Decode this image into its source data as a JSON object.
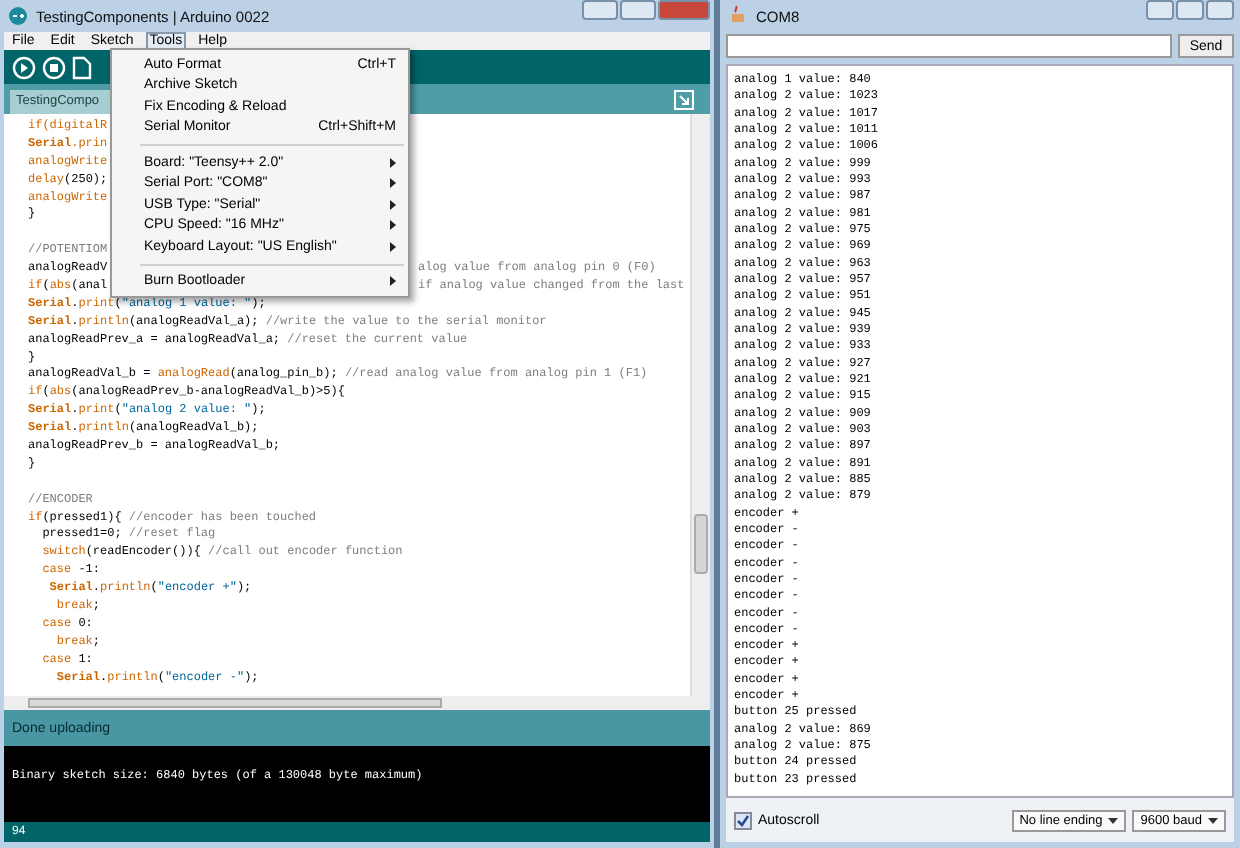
{
  "ide": {
    "title": "TestingComponents | Arduino 0022",
    "menubar": [
      {
        "label": "File",
        "selected": false
      },
      {
        "label": "Edit",
        "selected": false
      },
      {
        "label": "Sketch",
        "selected": false
      },
      {
        "label": "Tools",
        "selected": true
      },
      {
        "label": "Help",
        "selected": false
      }
    ],
    "tab": "TestingCompo",
    "code": [
      {
        "parts": [
          {
            "kind": "kw",
            "t": "if(digitalR"
          }
        ]
      },
      {
        "parts": [
          {
            "kind": "cls",
            "t": "Serial"
          },
          {
            "kind": "kw",
            "t": ".prin"
          }
        ]
      },
      {
        "parts": [
          {
            "kind": "kw",
            "t": "analogWrite"
          }
        ]
      },
      {
        "parts": [
          {
            "kind": "kw",
            "t": "delay"
          },
          {
            "kind": "plain",
            "t": "(250);"
          }
        ]
      },
      {
        "parts": [
          {
            "kind": "kw",
            "t": "analogWrite"
          }
        ]
      },
      {
        "parts": [
          {
            "kind": "plain",
            "t": "}"
          }
        ]
      },
      {
        "space_before": true,
        "parts": [
          {
            "kind": "cmt",
            "t": "//POTENTIOM"
          }
        ]
      },
      {
        "parts": [
          {
            "kind": "plain",
            "t": "analogReadV"
          }
        ],
        "tail": [
          {
            "kind": "cmt",
            "t": "alog value from analog pin 0 (F0)"
          }
        ]
      },
      {
        "parts": [
          {
            "kind": "kw",
            "t": "if"
          },
          {
            "kind": "plain",
            "t": "("
          },
          {
            "kind": "kw",
            "t": "abs"
          },
          {
            "kind": "plain",
            "t": "(anal"
          }
        ],
        "tail": [
          {
            "kind": "cmt",
            "t": "if analog value changed from the last"
          }
        ]
      },
      {
        "parts": [
          {
            "kind": "cls",
            "t": "Serial"
          },
          {
            "kind": "plain",
            "t": "."
          },
          {
            "kind": "kw",
            "t": "print"
          },
          {
            "kind": "plain",
            "t": "("
          },
          {
            "kind": "str",
            "t": "\"analog 1 value: \""
          },
          {
            "kind": "plain",
            "t": ");"
          }
        ]
      },
      {
        "parts": [
          {
            "kind": "cls",
            "t": "Serial"
          },
          {
            "kind": "plain",
            "t": "."
          },
          {
            "kind": "kw",
            "t": "println"
          },
          {
            "kind": "plain",
            "t": "(analogReadVal_a); "
          },
          {
            "kind": "cmt",
            "t": "//write the value to the serial monitor"
          }
        ]
      },
      {
        "parts": [
          {
            "kind": "plain",
            "t": "analogReadPrev_a = analogReadVal_a; "
          },
          {
            "kind": "cmt",
            "t": "//reset the current value"
          }
        ]
      },
      {
        "parts": [
          {
            "kind": "plain",
            "t": "}"
          }
        ]
      },
      {
        "parts": [
          {
            "kind": "plain",
            "t": "analogReadVal_b = "
          },
          {
            "kind": "kw",
            "t": "analogRead"
          },
          {
            "kind": "plain",
            "t": "(analog_pin_b); "
          },
          {
            "kind": "cmt",
            "t": "//read analog value from analog pin 1 (F1)"
          }
        ]
      },
      {
        "parts": [
          {
            "kind": "kw",
            "t": "if"
          },
          {
            "kind": "plain",
            "t": "("
          },
          {
            "kind": "kw",
            "t": "abs"
          },
          {
            "kind": "plain",
            "t": "(analogReadPrev_b-analogReadVal_b)>5){"
          }
        ]
      },
      {
        "parts": [
          {
            "kind": "cls",
            "t": "Serial"
          },
          {
            "kind": "plain",
            "t": "."
          },
          {
            "kind": "kw",
            "t": "print"
          },
          {
            "kind": "plain",
            "t": "("
          },
          {
            "kind": "str",
            "t": "\"analog 2 value: \""
          },
          {
            "kind": "plain",
            "t": ");"
          }
        ]
      },
      {
        "parts": [
          {
            "kind": "cls",
            "t": "Serial"
          },
          {
            "kind": "plain",
            "t": "."
          },
          {
            "kind": "kw",
            "t": "println"
          },
          {
            "kind": "plain",
            "t": "(analogReadVal_b);"
          }
        ]
      },
      {
        "parts": [
          {
            "kind": "plain",
            "t": "analogReadPrev_b = analogReadVal_b;"
          }
        ]
      },
      {
        "parts": [
          {
            "kind": "plain",
            "t": "}"
          }
        ]
      },
      {
        "space_before": true,
        "parts": [
          {
            "kind": "cmt",
            "t": "//ENCODER"
          }
        ]
      },
      {
        "parts": [
          {
            "kind": "kw",
            "t": "if"
          },
          {
            "kind": "plain",
            "t": "(pressed1){ "
          },
          {
            "kind": "cmt",
            "t": "//encoder has been touched"
          }
        ]
      },
      {
        "parts": [
          {
            "kind": "plain",
            "t": "  pressed1=0; "
          },
          {
            "kind": "cmt",
            "t": "//reset flag"
          }
        ]
      },
      {
        "parts": [
          {
            "kind": "kw",
            "t": "  switch"
          },
          {
            "kind": "plain",
            "t": "(readEncoder()){ "
          },
          {
            "kind": "cmt",
            "t": "//call out encoder function"
          }
        ]
      },
      {
        "parts": [
          {
            "kind": "kw",
            "t": "  case"
          },
          {
            "kind": "plain",
            "t": " -1:"
          }
        ]
      },
      {
        "parts": [
          {
            "kind": "cls",
            "t": "   Serial"
          },
          {
            "kind": "plain",
            "t": "."
          },
          {
            "kind": "kw",
            "t": "println"
          },
          {
            "kind": "plain",
            "t": "("
          },
          {
            "kind": "str",
            "t": "\"encoder +\""
          },
          {
            "kind": "plain",
            "t": ");"
          }
        ]
      },
      {
        "parts": [
          {
            "kind": "kw",
            "t": "    break"
          },
          {
            "kind": "plain",
            "t": ";"
          }
        ]
      },
      {
        "parts": [
          {
            "kind": "kw",
            "t": "  case"
          },
          {
            "kind": "plain",
            "t": " 0:"
          }
        ]
      },
      {
        "parts": [
          {
            "kind": "kw",
            "t": "    break"
          },
          {
            "kind": "plain",
            "t": ";"
          }
        ]
      },
      {
        "parts": [
          {
            "kind": "kw",
            "t": "  case"
          },
          {
            "kind": "plain",
            "t": " 1:"
          }
        ]
      },
      {
        "parts": [
          {
            "kind": "cls",
            "t": "    Serial"
          },
          {
            "kind": "plain",
            "t": "."
          },
          {
            "kind": "kw",
            "t": "println"
          },
          {
            "kind": "plain",
            "t": "("
          },
          {
            "kind": "str",
            "t": "\"encoder -\""
          },
          {
            "kind": "plain",
            "t": ");"
          }
        ]
      }
    ],
    "menu": [
      {
        "kind": "command",
        "label": "Auto Format",
        "shortcut": "Ctrl+T"
      },
      {
        "kind": "command",
        "label": "Archive Sketch"
      },
      {
        "kind": "command",
        "label": "Fix Encoding & Reload"
      },
      {
        "kind": "command",
        "label": "Serial Monitor",
        "shortcut": "Ctrl+Shift+M"
      },
      {
        "kind": "separator"
      },
      {
        "kind": "submenu",
        "label": "Board: \"Teensy++ 2.0\""
      },
      {
        "kind": "submenu",
        "label": "Serial Port: \"COM8\""
      },
      {
        "kind": "submenu",
        "label": "USB Type: \"Serial\""
      },
      {
        "kind": "submenu",
        "label": "CPU Speed: \"16 MHz\""
      },
      {
        "kind": "submenu",
        "label": "Keyboard Layout: \"US English\""
      },
      {
        "kind": "separator"
      },
      {
        "kind": "submenu",
        "label": "Burn Bootloader"
      }
    ],
    "status": "Done uploading",
    "console": "Binary sketch size: 6840 bytes (of a 130048 byte maximum)",
    "line_number": "94"
  },
  "serial": {
    "title": "COM8",
    "send": "Send",
    "output": [
      "analog 1 value: 840",
      "analog 2 value: 1023",
      "analog 2 value: 1017",
      "analog 2 value: 1011",
      "analog 2 value: 1006",
      "analog 2 value: 999",
      "analog 2 value: 993",
      "analog 2 value: 987",
      "analog 2 value: 981",
      "analog 2 value: 975",
      "analog 2 value: 969",
      "analog 2 value: 963",
      "analog 2 value: 957",
      "analog 2 value: 951",
      "analog 2 value: 945",
      "analog 2 value: 939",
      "analog 2 value: 933",
      "analog 2 value: 927",
      "analog 2 value: 921",
      "analog 2 value: 915",
      "analog 2 value: 909",
      "analog 2 value: 903",
      "analog 2 value: 897",
      "analog 2 value: 891",
      "analog 2 value: 885",
      "analog 2 value: 879",
      "encoder +",
      "encoder -",
      "encoder -",
      "encoder -",
      "encoder -",
      "encoder -",
      "encoder -",
      "encoder -",
      "encoder +",
      "encoder +",
      "encoder +",
      "encoder +",
      "button 25 pressed",
      "analog 2 value: 869",
      "analog 2 value: 875",
      "button 24 pressed",
      "button 23 pressed"
    ],
    "autoscroll": {
      "label": "Autoscroll",
      "checked": true
    },
    "line_ending": "No line ending",
    "baud": "9600 baud"
  }
}
